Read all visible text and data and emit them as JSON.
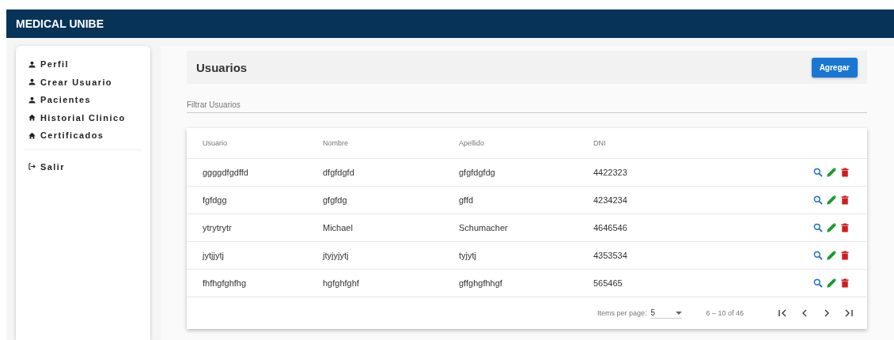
{
  "app_bar": {
    "title": "MEDICAL UNIBE"
  },
  "sidebar": {
    "items": [
      {
        "label": "Perfil",
        "kind": "person"
      },
      {
        "label": "Crear Usuario",
        "kind": "person"
      },
      {
        "label": "Pacientes",
        "kind": "person"
      },
      {
        "label": "Historial Clinico",
        "kind": "home"
      },
      {
        "label": "Certificados",
        "kind": "home"
      }
    ],
    "footer_items": [
      {
        "label": "Salir",
        "kind": "logout"
      }
    ]
  },
  "page": {
    "title": "Usuarios",
    "add_button": "Agregar"
  },
  "filter": {
    "placeholder": "Filtrar Usuarios"
  },
  "table": {
    "columns": [
      "Usuario",
      "Nombre",
      "Apellido",
      "DNI"
    ],
    "rows": [
      [
        "ggggdfgdffd",
        "dfgfdgfd",
        "gfgfdgfdg",
        "4422323"
      ],
      [
        "fgfdgg",
        "gfgfdg",
        "gffd",
        "4234234"
      ],
      [
        "ytrytrytr",
        "Michael",
        "Schumacher",
        "4646546"
      ],
      [
        "jytjjytj",
        "jtyjyjytj",
        "tyjytj",
        "4353534"
      ],
      [
        "fhfhgfghfhg",
        "hgfghfghf",
        "gffghgfhhgf",
        "565465"
      ]
    ]
  },
  "paginator": {
    "items_label": "Items per page:",
    "page_size": "5",
    "range": "6 – 10 of 46"
  }
}
